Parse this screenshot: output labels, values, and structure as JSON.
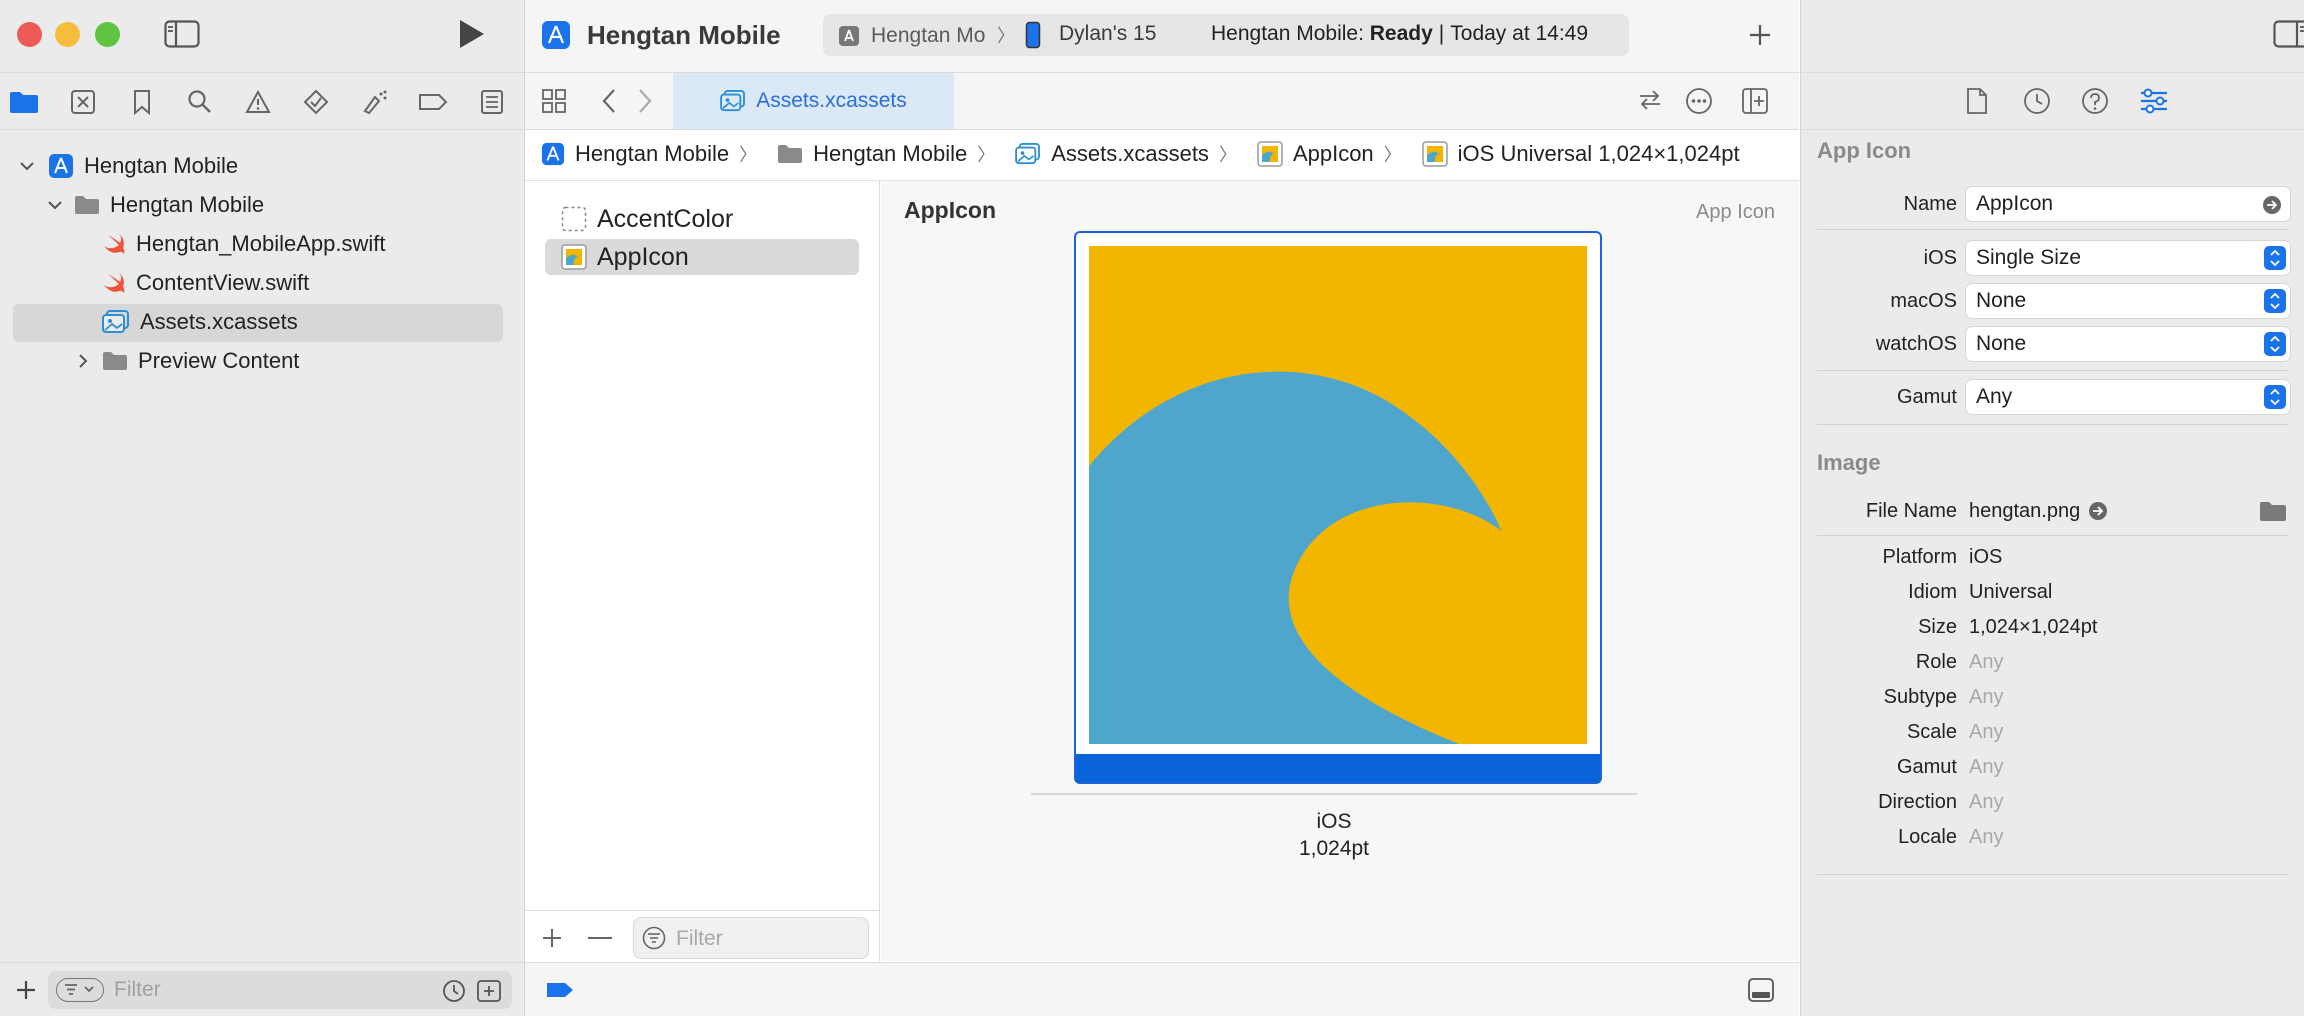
{
  "navigator": {
    "tree": [
      {
        "label": "Hengtan Mobile",
        "kind": "project",
        "expanded": true
      },
      {
        "label": "Hengtan Mobile",
        "kind": "folder",
        "expanded": true
      },
      {
        "label": "Hengtan_MobileApp.swift",
        "kind": "swift"
      },
      {
        "label": "ContentView.swift",
        "kind": "swift"
      },
      {
        "label": "Assets.xcassets",
        "kind": "assets",
        "selected": true
      },
      {
        "label": "Preview Content",
        "kind": "folder",
        "expanded": false
      }
    ],
    "filter_placeholder": "Filter"
  },
  "toolbar": {
    "project_title": "Hengtan Mobile",
    "scheme": "Hengtan Mo",
    "device": "Dylan's 15",
    "status_prefix": "Hengtan Mobile: ",
    "status_state": "Ready",
    "status_time": "Today at 14:49"
  },
  "tabs": [
    {
      "label": "Assets.xcassets"
    }
  ],
  "breadcrumb": [
    {
      "label": "Hengtan Mobile"
    },
    {
      "label": "Hengtan Mobile"
    },
    {
      "label": "Assets.xcassets"
    },
    {
      "label": "AppIcon"
    },
    {
      "label": "iOS Universal 1,024×1,024pt"
    }
  ],
  "asset_list": {
    "items": [
      {
        "label": "AccentColor"
      },
      {
        "label": "AppIcon",
        "selected": true
      }
    ],
    "filter_placeholder": "Filter"
  },
  "canvas": {
    "set_name": "AppIcon",
    "set_type": "App Icon",
    "slot_platform": "iOS",
    "slot_size": "1,024pt"
  },
  "inspector": {
    "app_icon_header": "App Icon",
    "name_label": "Name",
    "name_value": "AppIcon",
    "ios_label": "iOS",
    "ios_value": "Single Size",
    "macos_label": "macOS",
    "macos_value": "None",
    "watchos_label": "watchOS",
    "watchos_value": "None",
    "gamut_label": "Gamut",
    "gamut_value": "Any",
    "image_header": "Image",
    "file_name_label": "File Name",
    "file_name_value": "hengtan.png",
    "props": [
      {
        "k": "Platform",
        "v": "iOS",
        "dim": false
      },
      {
        "k": "Idiom",
        "v": "Universal",
        "dim": false
      },
      {
        "k": "Size",
        "v": "1,024×1,024pt",
        "dim": false
      },
      {
        "k": "Role",
        "v": "Any",
        "dim": true
      },
      {
        "k": "Subtype",
        "v": "Any",
        "dim": true
      },
      {
        "k": "Scale",
        "v": "Any",
        "dim": true
      },
      {
        "k": "Gamut",
        "v": "Any",
        "dim": true
      },
      {
        "k": "Direction",
        "v": "Any",
        "dim": true
      },
      {
        "k": "Locale",
        "v": "Any",
        "dim": true
      }
    ]
  },
  "colors": {
    "accent": "#1a73e8",
    "icon_background": "#f2b600",
    "icon_wave": "#4fa6cd"
  }
}
